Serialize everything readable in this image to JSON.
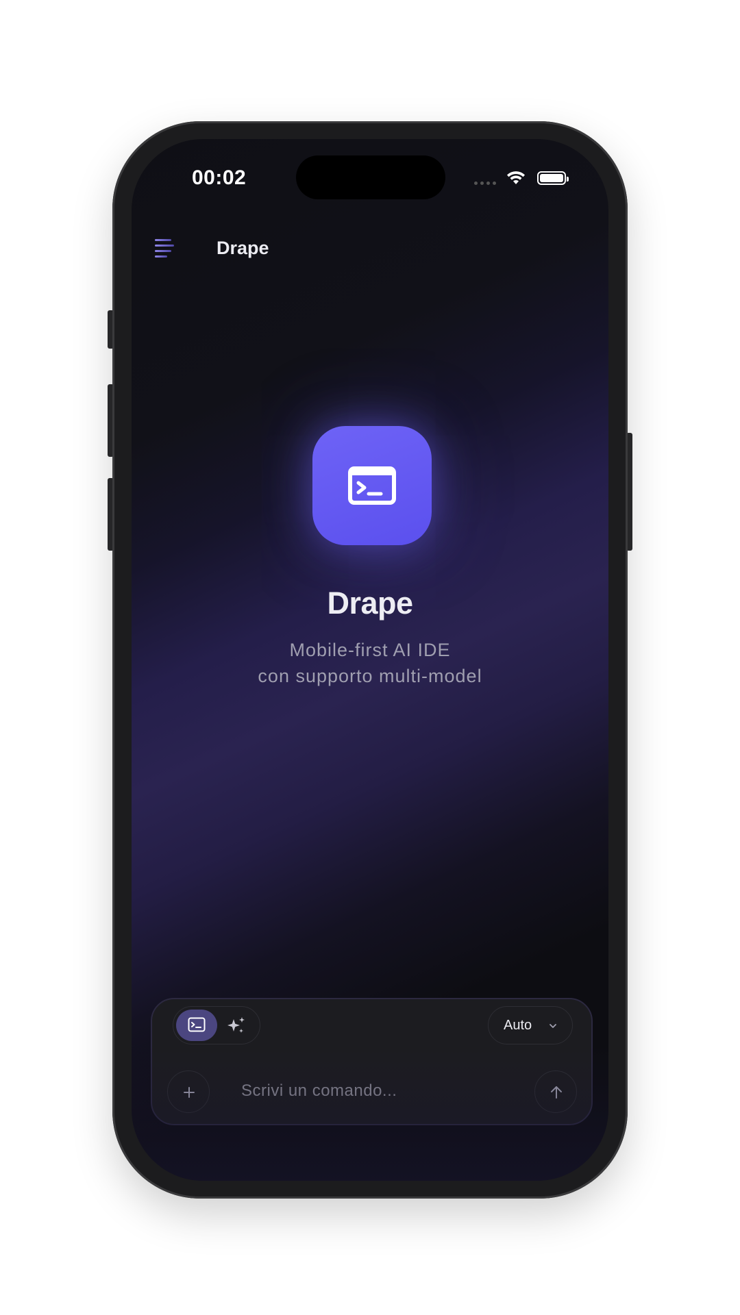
{
  "status_bar": {
    "time": "00:02"
  },
  "header": {
    "title": "Drape",
    "menu_icon": "menu-icon"
  },
  "hero": {
    "app_icon": "terminal-icon",
    "title": "Drape",
    "subtitle_line1": "Mobile-first AI IDE",
    "subtitle_line2": "con supporto multi-model"
  },
  "composer": {
    "modes": [
      {
        "name": "terminal",
        "icon": "terminal-icon",
        "selected": true
      },
      {
        "name": "ai",
        "icon": "sparkles-icon",
        "selected": false
      }
    ],
    "model_selector": {
      "value": "Auto",
      "icon": "chevron-down-icon"
    },
    "add_icon": "plus-icon",
    "input_placeholder": "Scrivi un comando...",
    "send_icon": "arrow-up-icon"
  },
  "colors": {
    "accent": "#6359f0",
    "accent_mode_bg": "#4b4680",
    "background": "#0f0f15",
    "text_primary": "#ececf2",
    "text_secondary": "#a09fb0"
  }
}
